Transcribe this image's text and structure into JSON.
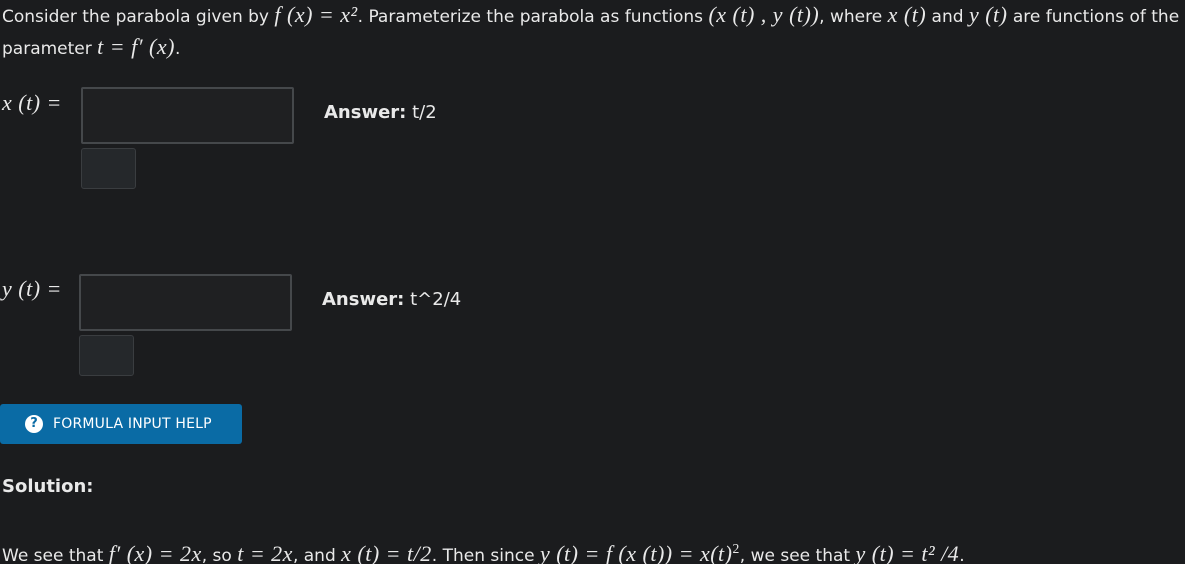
{
  "question": {
    "t1": "Consider the parabola given by ",
    "m1": "f (x) = x²",
    "t2": ". Parameterize the parabola as functions ",
    "m2": "(x (t) , y (t))",
    "t3": ", where ",
    "m3": "x (t)",
    "t4": " and ",
    "m4": "y (t)",
    "t5": " are functions of the parameter ",
    "m5": "t = f′ (x)",
    "t6": "."
  },
  "answers": [
    {
      "label": "x (t) =",
      "key": "Answer:",
      "value": "t/2"
    },
    {
      "label": "y (t) =",
      "key": "Answer:",
      "value": "t^2/4"
    }
  ],
  "help_button": {
    "icon": "?",
    "label": "FORMULA INPUT HELP"
  },
  "solution": {
    "title": "Solution:",
    "t1": "We see that ",
    "m1": "f′ (x) = 2x",
    "t2": ", so ",
    "m2": "t = 2x",
    "t3": ", and ",
    "m3": "x (t) = t/2",
    "t4": ". Then since ",
    "m4": "y (t) = f (x (t)) = x(t)",
    "m4_sup": "2",
    "t5": ", we see that ",
    "m5": "y (t) = t² /4",
    "t6": "."
  },
  "colors": {
    "background": "#1b1c1e",
    "text": "#e9e9e9",
    "help_button": "#0a6ba5"
  }
}
